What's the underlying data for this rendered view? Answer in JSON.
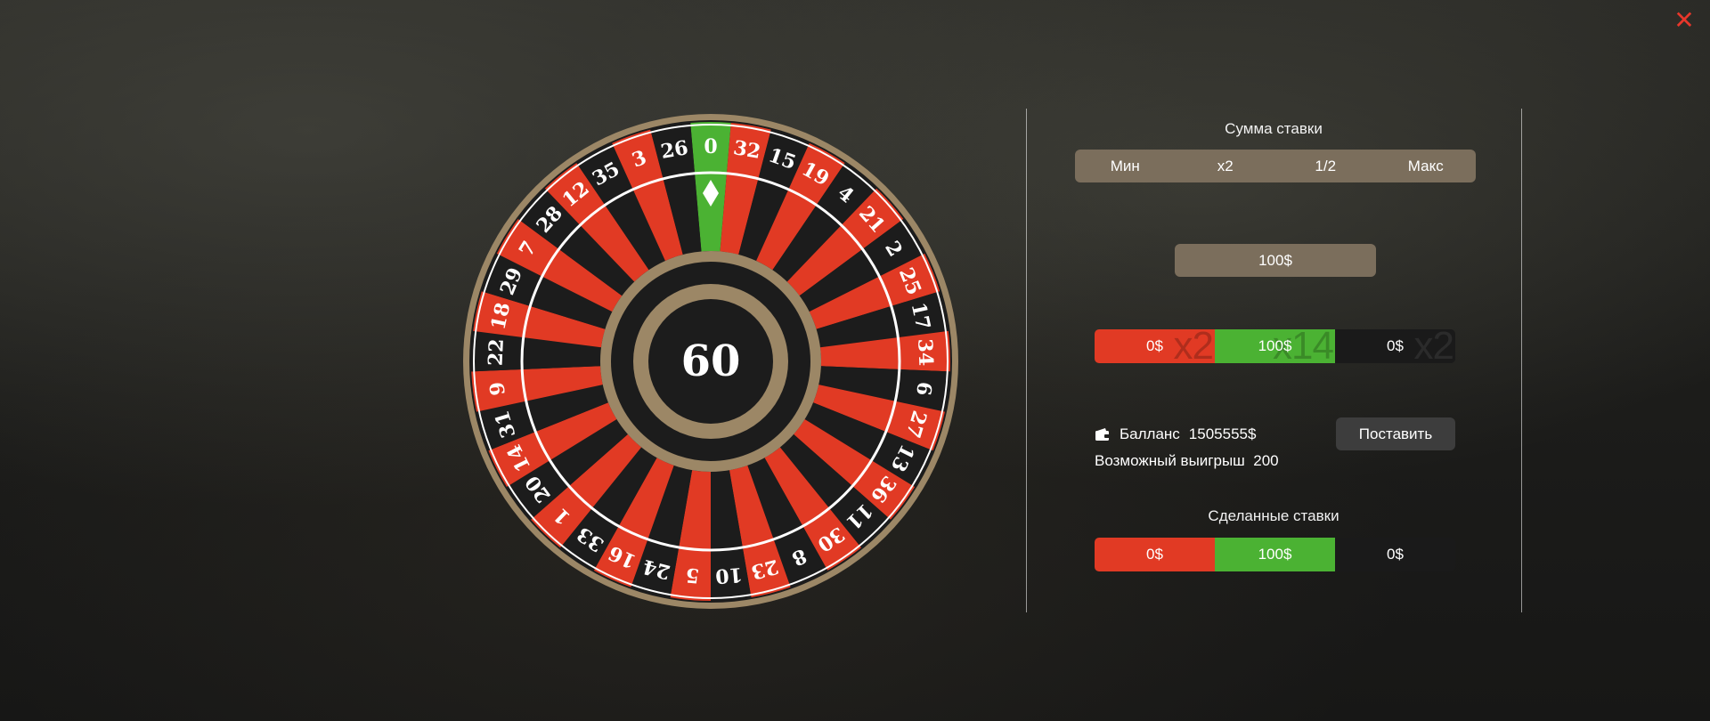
{
  "wheel": {
    "timer": "60",
    "numbers": [
      "0",
      "32",
      "15",
      "19",
      "4",
      "21",
      "2",
      "25",
      "17",
      "34",
      "6",
      "27",
      "13",
      "36",
      "11",
      "30",
      "8",
      "23",
      "10",
      "5",
      "24",
      "16",
      "33",
      "1",
      "20",
      "14",
      "31",
      "9",
      "22",
      "18",
      "29",
      "7",
      "28",
      "12",
      "35",
      "3",
      "26"
    ],
    "colors": {
      "red": "#e13a24",
      "black": "#1c1c1c",
      "green": "#4bb233",
      "gold": "#9c8766",
      "white": "#ffffff"
    }
  },
  "panel": {
    "bet_title": "Сумма ставки",
    "controls": {
      "min": "Мин",
      "double": "x2",
      "half": "1/2",
      "max": "Макс"
    },
    "amount": "100$",
    "choices": [
      {
        "value": "0$",
        "multiplier": "x2"
      },
      {
        "value": "100$",
        "multiplier": "x14"
      },
      {
        "value": "0$",
        "multiplier": "x2"
      }
    ],
    "balance_label": "Балланс",
    "balance_value": "1505555$",
    "potential_label": "Возможный выигрыш",
    "potential_value": "200",
    "place_button": "Поставить",
    "made_title": "Сделанные ставки",
    "made": [
      "0$",
      "100$",
      "0$"
    ]
  },
  "icons": {
    "close": "close-icon",
    "wallet": "wallet-icon",
    "pointer": "diamond-pointer-icon"
  }
}
